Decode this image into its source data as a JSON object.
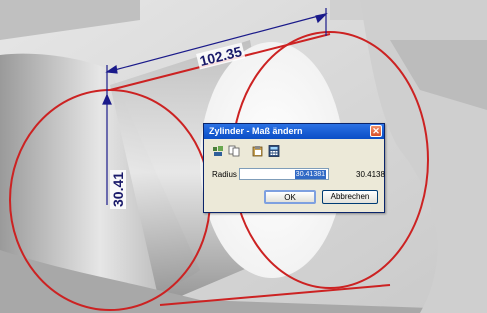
{
  "dimensions": {
    "horizontal": "102.35",
    "vertical": "30.41"
  },
  "dialog": {
    "title": "Zylinder - Maß ändern",
    "close_glyph": "✕",
    "toolbar_icons": [
      "mesh-icon",
      "copy-icon",
      "clipboard-icon",
      "calculator-icon"
    ],
    "radius_label": "Radius",
    "radius_value": "30.41381",
    "radius_current": "30.4138",
    "ok_label": "OK",
    "cancel_label": "Abbrechen"
  },
  "colors": {
    "model_edge": "#cc2222",
    "dimension": "#1a1a8a",
    "titlebar": "#0a4ec6"
  }
}
